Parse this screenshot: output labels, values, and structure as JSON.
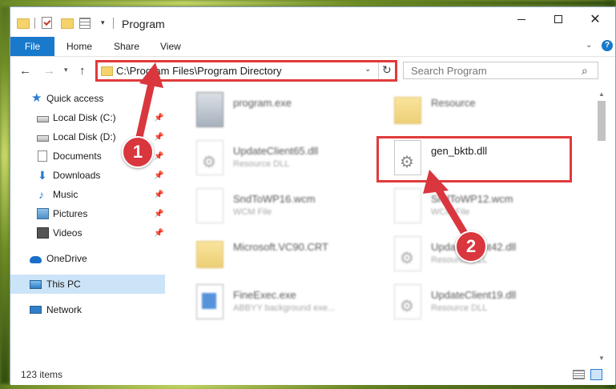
{
  "window": {
    "title": "Program"
  },
  "ribbon": {
    "tabs": [
      "File",
      "Home",
      "Share",
      "View"
    ],
    "help_label": "?"
  },
  "navbar": {
    "address": "C:\\Program Files\\Program Directory",
    "search_placeholder": "Search Program"
  },
  "sidebar": {
    "items": [
      {
        "label": "Quick access",
        "icon": "star-icon",
        "pinned": false
      },
      {
        "label": "Local Disk (C:)",
        "icon": "drive-icon",
        "pinned": true
      },
      {
        "label": "Local Disk (D:)",
        "icon": "drive-icon",
        "pinned": true
      },
      {
        "label": "Documents",
        "icon": "documents-icon",
        "pinned": true
      },
      {
        "label": "Downloads",
        "icon": "downloads-icon",
        "pinned": true
      },
      {
        "label": "Music",
        "icon": "music-icon",
        "pinned": true
      },
      {
        "label": "Pictures",
        "icon": "pictures-icon",
        "pinned": true
      },
      {
        "label": "Videos",
        "icon": "videos-icon",
        "pinned": true
      },
      {
        "label": "OneDrive",
        "icon": "onedrive-icon",
        "pinned": false
      },
      {
        "label": "This PC",
        "icon": "this-pc-icon",
        "pinned": false,
        "selected": true
      },
      {
        "label": "Network",
        "icon": "network-icon",
        "pinned": false
      }
    ]
  },
  "files": [
    {
      "name": "program.exe",
      "type": "",
      "icon": "exe-icon"
    },
    {
      "name": "Resource",
      "type": "",
      "icon": "folder-icon"
    },
    {
      "name": "UpdateClient65.dll",
      "type": "Resource DLL",
      "icon": "dll-icon"
    },
    {
      "name": "gen_bktb.dll",
      "type": "",
      "icon": "dll-icon"
    },
    {
      "name": "SndToWP16.wcm",
      "type": "WCM File",
      "icon": "file-icon"
    },
    {
      "name": "SndToWP12.wcm",
      "type": "WCM File",
      "icon": "file-icon"
    },
    {
      "name": "Microsoft.VC90.CRT",
      "type": "",
      "icon": "folder-icon"
    },
    {
      "name": "UpdateClient42.dll",
      "type": "Resource DLL",
      "icon": "dll-icon"
    },
    {
      "name": "FineExec.exe",
      "type": "ABBYY background exe...",
      "icon": "exe-icon"
    },
    {
      "name": "UpdateClient19.dll",
      "type": "Resource DLL",
      "icon": "dll-icon"
    }
  ],
  "status": {
    "item_count": "123 items"
  },
  "annotations": {
    "marker_1": "1",
    "marker_2": "2",
    "accent_color": "#e03a3a"
  }
}
